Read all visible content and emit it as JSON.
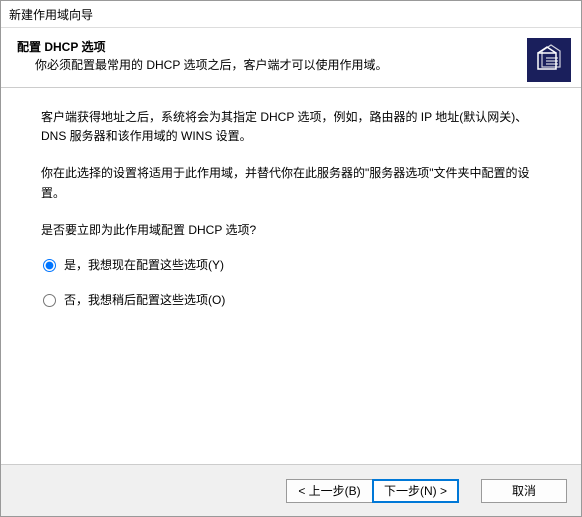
{
  "window": {
    "title": "新建作用域向导"
  },
  "header": {
    "title": "配置 DHCP 选项",
    "subtitle": "你必须配置最常用的 DHCP 选项之后，客户端才可以使用作用域。"
  },
  "body": {
    "para1": "客户端获得地址之后，系统将会为其指定 DHCP 选项，例如，路由器的 IP 地址(默认网关)、DNS 服务器和该作用域的 WINS 设置。",
    "para2": "你在此选择的设置将适用于此作用域，并替代你在此服务器的\"服务器选项\"文件夹中配置的设置。",
    "question": "是否要立即为此作用域配置 DHCP 选项?",
    "options": {
      "yes": "是，我想现在配置这些选项(Y)",
      "no": "否，我想稍后配置这些选项(O)"
    }
  },
  "footer": {
    "back": "< 上一步(B)",
    "next": "下一步(N) >",
    "cancel": "取消"
  }
}
